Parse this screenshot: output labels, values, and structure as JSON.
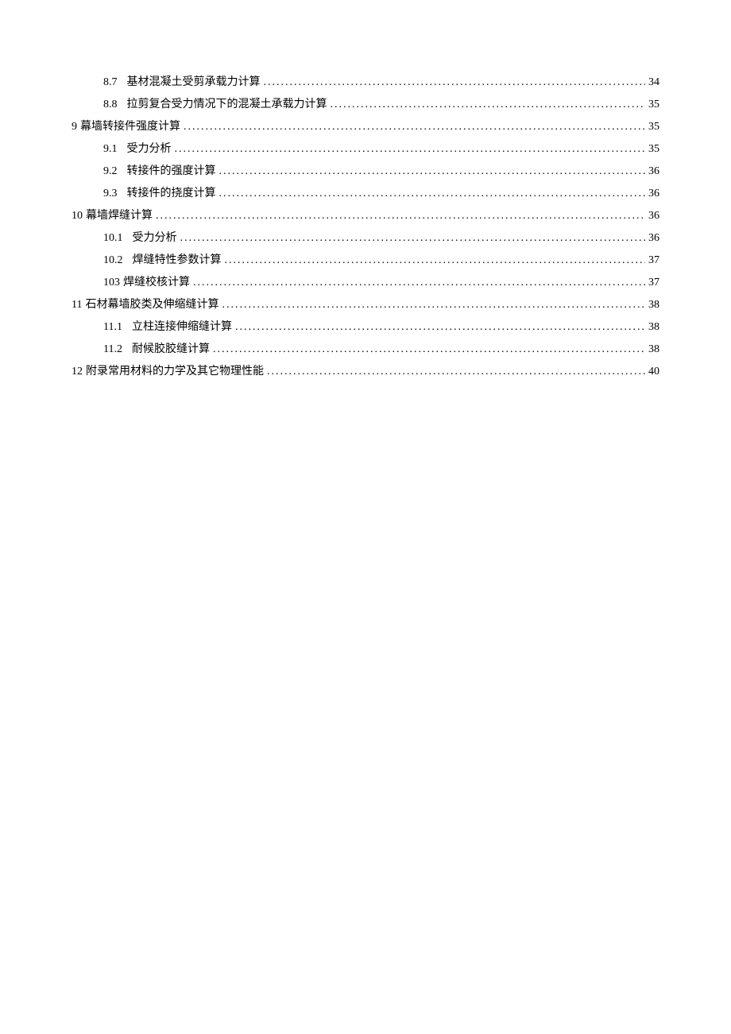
{
  "toc": [
    {
      "indent": 1,
      "num": "8.7",
      "title": "基材混凝土受剪承载力计算",
      "page": "34"
    },
    {
      "indent": 1,
      "num": "8.8",
      "title": "拉剪复合受力情况下的混凝土承载力计算",
      "page": "35"
    },
    {
      "indent": 0,
      "num": "9",
      "title": "幕墙转接件强度计算",
      "page": "35",
      "tight": true
    },
    {
      "indent": 1,
      "num": "9.1",
      "title": "受力分析",
      "page": "35"
    },
    {
      "indent": 1,
      "num": "9.2",
      "title": "转接件的强度计算",
      "page": "36"
    },
    {
      "indent": 1,
      "num": "9.3",
      "title": "转接件的挠度计算",
      "page": "36"
    },
    {
      "indent": 0,
      "num": "10",
      "title": "幕墙焊缝计算",
      "page": "36",
      "tight": true
    },
    {
      "indent": 1,
      "num": "10.1",
      "title": "受力分析",
      "page": "36"
    },
    {
      "indent": 1,
      "num": "10.2",
      "title": "焊缝特性参数计算",
      "page": "37"
    },
    {
      "indent": 1,
      "num": "103",
      "title": "焊缝校核计算",
      "page": "37",
      "tight": true
    },
    {
      "indent": 0,
      "num": "11",
      "title": "石材幕墙胶类及伸缩缝计算",
      "page": "38",
      "tight": true
    },
    {
      "indent": 1,
      "num": "11.1",
      "title": "立柱连接伸缩缝计算",
      "page": "38"
    },
    {
      "indent": 1,
      "num": "11.2",
      "title": "耐候胶胶缝计算",
      "page": "38"
    },
    {
      "indent": 0,
      "num": "12",
      "title": "附录常用材料的力学及其它物理性能",
      "page": "40",
      "tight": true
    }
  ]
}
